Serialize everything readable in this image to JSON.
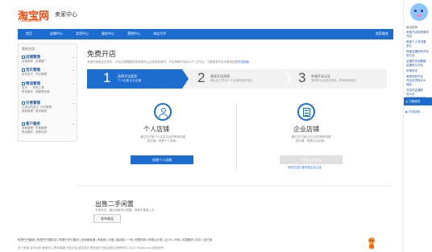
{
  "header": {
    "logo_cn": "淘宝网",
    "logo_en": "Taobao.com",
    "title": "卖家中心"
  },
  "nav": {
    "items": [
      "首页",
      "店铺中心",
      "发货中心",
      "服务中心",
      "营销中心",
      "淘宝大学"
    ],
    "right": "卖家服务"
  },
  "sidebar": {
    "head": "我的应用",
    "groups": [
      {
        "title": "店铺管理",
        "links": [
          "店铺装修",
          "店铺推广"
        ]
      },
      {
        "title": "宝贝管理",
        "links": [
          "发布宝贝",
          "评价管理"
        ]
      },
      {
        "title": "物流管理",
        "links": [
          "发货",
          "物流工具",
          "物流服务",
          "我要寄快递"
        ]
      },
      {
        "title": "交易管理",
        "links": [
          "已卖出的宝贝",
          "评价管理",
          "退款管理",
          "退货管理"
        ]
      },
      {
        "title": "客户服务",
        "links": [
          "退款管理",
          "举报管理",
          "售后服务",
          "违规记录"
        ]
      }
    ]
  },
  "main": {
    "title": "免费开店",
    "desc": "亲爱的淘宝会员您好，开店过程需要您完成相关认证及信息填写，开店审核时间为1-3个工作日。了解更多开店详情请查看",
    "desc_link": "开店指南",
    "steps": [
      {
        "num": "1",
        "t1": "选择开店类型",
        "t2": "个人店铺 企业店铺"
      },
      {
        "num": "2",
        "t1": "阅读开店须知",
        "t2": "确认自己符合个人店铺的相关规定"
      },
      {
        "num": "3",
        "t1": "申请开店认证",
        "t2": "需提供认证相关资料，等待审核通过"
      }
    ],
    "personal": {
      "title": "个人店铺",
      "desc1": "通过支付宝个人实名认证的商家创建",
      "desc2": "的店铺，就是个人店铺。",
      "button": "创建个人店铺"
    },
    "enterprise": {
      "title": "企业店铺",
      "desc1": "通过支付宝企业认证的商家创建",
      "desc2": "的店铺，就是企业店铺。",
      "button": "创建企业店铺",
      "link": "请先在支付宝完成企业认证"
    },
    "second": {
      "title": "出售二手闲置",
      "desc": "不用开店，通过闲鱼转让闲置，简单方便易上手。",
      "button": "发布商品"
    }
  },
  "footer": {
    "links": "阿里巴巴集团 | 阿里巴巴国际站 | 阿里巴巴中国站 | 全球速卖通 | 淘宝网 | 天猫 | 聚划算 | 一淘 | 阿里妈妈 | 阿里云计算 | 云OS | 万网 | 中国雅虎 | 钉钉 | 支付宝",
    "copy": "关于淘宝  合作伙伴  营销中心  联系客服  开放平台  诚征英才  联系我们  网站地图  法律声明   © 2016 Taobao.com 版权所有"
  },
  "right_panel": {
    "items": [
      "新品推荐：",
      "淘宝开店如何操作",
      "开店",
      "淘宝个人开店要",
      "多久",
      "淘宝店铺如何开店",
      "的方法",
      "店铺开店流程图",
      "店铺怎么开店",
      "申请开店",
      "卖家如何开店",
      "开店必须有什么",
      "商品",
      "开店时会遇到",
      "怎么办",
      "如何在淘宝开店",
      "店铺转让注意事项"
    ],
    "btn1": "万象服务",
    "btn2": "在线咨询"
  }
}
